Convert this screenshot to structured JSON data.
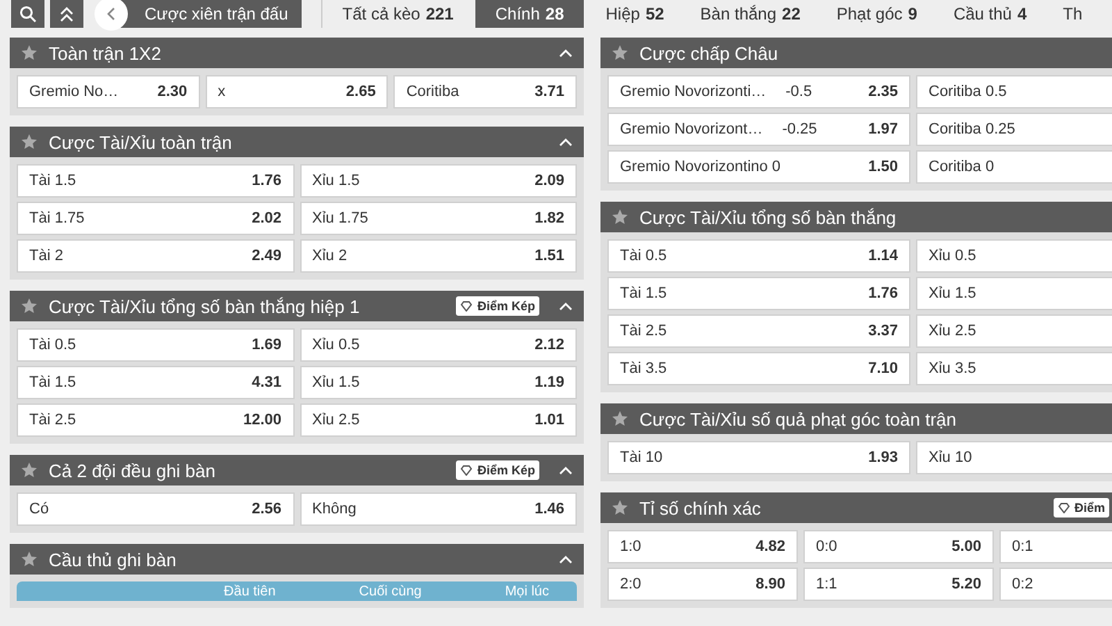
{
  "toolbar": {
    "parlay_button": "Cược xiên trận đấu"
  },
  "tabs": [
    {
      "label": "Tất cả kèo",
      "count": "221",
      "selected": false
    },
    {
      "label": "Chính",
      "count": "28",
      "selected": true
    },
    {
      "label": "Hiệp",
      "count": "52",
      "selected": false
    },
    {
      "label": "Bàn thắng",
      "count": "22",
      "selected": false
    },
    {
      "label": "Phạt góc",
      "count": "9",
      "selected": false
    },
    {
      "label": "Cầu thủ",
      "count": "4",
      "selected": false
    },
    {
      "label": "Th",
      "selected": false
    }
  ],
  "left_column": [
    {
      "title": "Toàn trận 1X2",
      "rows": [
        [
          {
            "label": "Gremio No…",
            "odds": "2.30"
          },
          {
            "label": "x",
            "odds": "2.65"
          },
          {
            "label": "Coritiba",
            "odds": "3.71"
          }
        ]
      ]
    },
    {
      "title": "Cược Tài/Xỉu toàn trận",
      "rows": [
        [
          {
            "label": "Tài 1.5",
            "odds": "1.76"
          },
          {
            "label": "Xỉu 1.5",
            "odds": "2.09"
          }
        ],
        [
          {
            "label": "Tài 1.75",
            "odds": "2.02"
          },
          {
            "label": "Xỉu 1.75",
            "odds": "1.82"
          }
        ],
        [
          {
            "label": "Tài 2",
            "odds": "2.49"
          },
          {
            "label": "Xỉu 2",
            "odds": "1.51"
          }
        ]
      ]
    },
    {
      "title": "Cược Tài/Xỉu tổng số bàn thắng hiệp 1",
      "badge": "Điểm Kép",
      "rows": [
        [
          {
            "label": "Tài 0.5",
            "odds": "1.69"
          },
          {
            "label": "Xỉu 0.5",
            "odds": "2.12"
          }
        ],
        [
          {
            "label": "Tài 1.5",
            "odds": "4.31"
          },
          {
            "label": "Xỉu 1.5",
            "odds": "1.19"
          }
        ],
        [
          {
            "label": "Tài 2.5",
            "odds": "12.00"
          },
          {
            "label": "Xỉu 2.5",
            "odds": "1.01"
          }
        ]
      ]
    },
    {
      "title": "Cả 2 đội đều ghi bàn",
      "badge": "Điểm Kép",
      "rows": [
        [
          {
            "label": "Có",
            "odds": "2.56"
          },
          {
            "label": "Không",
            "odds": "1.46"
          }
        ]
      ]
    },
    {
      "title": "Cầu thủ ghi bàn",
      "columns": [
        "Đầu tiên",
        "Cuối cùng",
        "Mọi lúc"
      ]
    }
  ],
  "right_column": [
    {
      "title": "Cược chấp Châu",
      "rows": [
        [
          {
            "label": "Gremio Novorizonti…",
            "line": "-0.5",
            "odds": "2.35"
          },
          {
            "label": "Coritiba 0.5"
          }
        ],
        [
          {
            "label": "Gremio Novorizont…",
            "line": "-0.25",
            "odds": "1.97"
          },
          {
            "label": "Coritiba 0.25"
          }
        ],
        [
          {
            "label": "Gremio Novorizontino 0",
            "odds": "1.50"
          },
          {
            "label": "Coritiba 0"
          }
        ]
      ]
    },
    {
      "title": "Cược Tài/Xỉu tổng số bàn thắng",
      "rows": [
        [
          {
            "label": "Tài 0.5",
            "odds": "1.14"
          },
          {
            "label": "Xỉu 0.5"
          }
        ],
        [
          {
            "label": "Tài 1.5",
            "odds": "1.76"
          },
          {
            "label": "Xỉu 1.5"
          }
        ],
        [
          {
            "label": "Tài 2.5",
            "odds": "3.37"
          },
          {
            "label": "Xỉu 2.5"
          }
        ],
        [
          {
            "label": "Tài 3.5",
            "odds": "7.10"
          },
          {
            "label": "Xỉu 3.5"
          }
        ]
      ]
    },
    {
      "title": "Cược Tài/Xỉu số quả phạt góc toàn trận",
      "rows": [
        [
          {
            "label": "Tài 10",
            "odds": "1.93"
          },
          {
            "label": "Xỉu 10"
          }
        ]
      ]
    },
    {
      "title": "Tỉ số chính xác",
      "badge": "Điểm",
      "rows": [
        [
          {
            "label": "1:0",
            "odds": "4.82"
          },
          {
            "label": "0:0",
            "odds": "5.00"
          },
          {
            "label": "0:1"
          }
        ],
        [
          {
            "label": "2:0",
            "odds": "8.90"
          },
          {
            "label": "1:1",
            "odds": "5.20"
          },
          {
            "label": "0:2"
          }
        ]
      ]
    }
  ]
}
